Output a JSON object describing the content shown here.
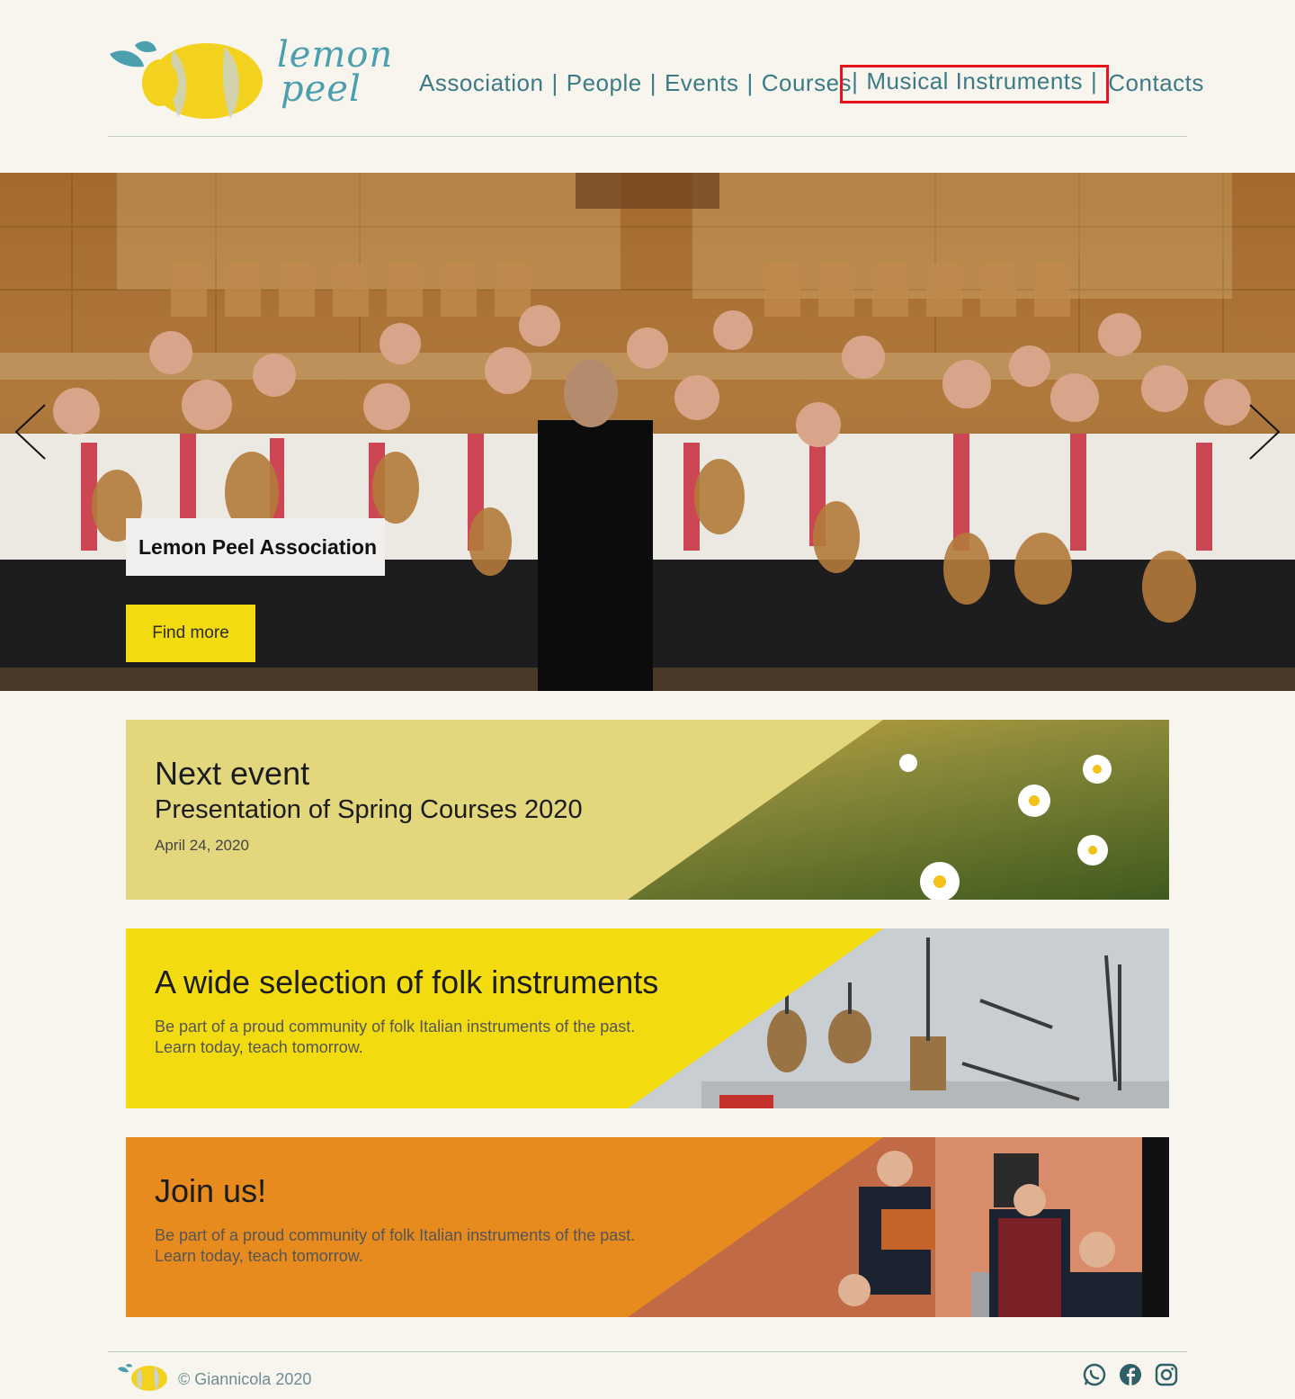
{
  "brand": {
    "logo_line1": "lemon",
    "logo_line2": "peel",
    "accent_teal": "#4b9fae",
    "accent_yellow": "#f2dc10"
  },
  "nav": {
    "items": [
      {
        "label": "Association"
      },
      {
        "label": "People"
      },
      {
        "label": "Events"
      },
      {
        "label": "Courses"
      },
      {
        "label": "Musical Instruments"
      },
      {
        "label": "Contacts"
      }
    ],
    "separator": "|"
  },
  "hero": {
    "caption": "Lemon Peel Association",
    "button_label": "Find more",
    "prev_icon": "chevron-left-icon",
    "next_icon": "chevron-right-icon"
  },
  "cards": [
    {
      "title": "Next event",
      "subtitle": "Presentation of Spring Courses 2020",
      "date": "April 24, 2020",
      "color": "#e3d77d"
    },
    {
      "title": "A wide selection of folk instruments",
      "line1": "Be part of a proud community of folk Italian instruments of the past.",
      "line2": "Learn today, teach tomorrow.",
      "color": "#f2dc10"
    },
    {
      "title": "Join us!",
      "line1": "Be part of a proud community of folk Italian instruments of the past.",
      "line2": "Learn today, teach tomorrow.",
      "color": "#e78b1f"
    }
  ],
  "footer": {
    "copyright": "© Giannicola 2020",
    "social": [
      "whatsapp-icon",
      "facebook-icon",
      "instagram-icon"
    ]
  }
}
